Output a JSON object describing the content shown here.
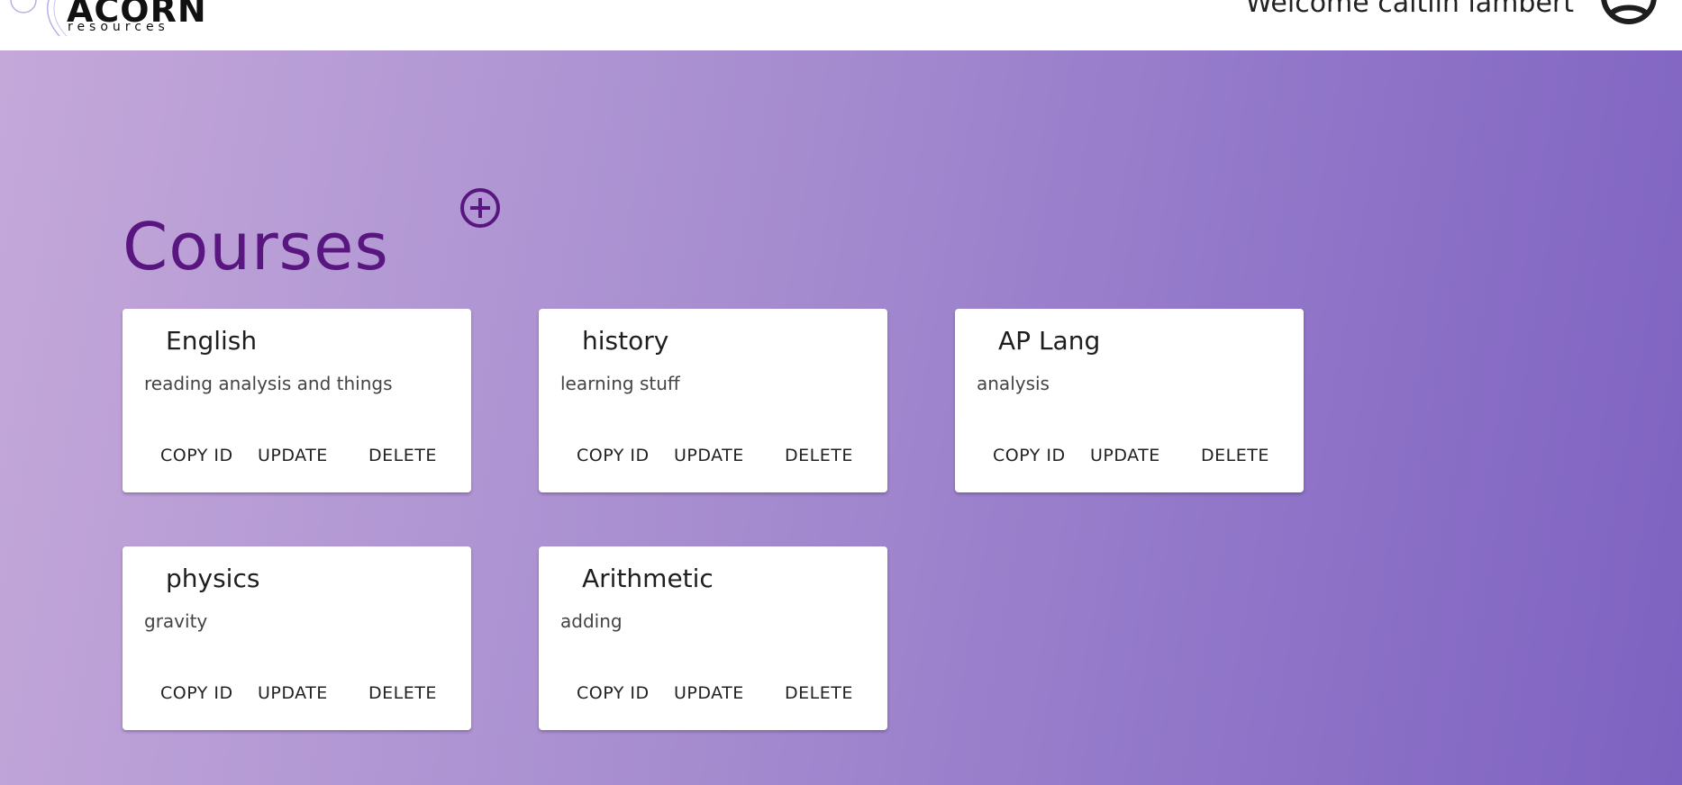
{
  "header": {
    "logo_word": "ACORN",
    "logo_sub": "resources",
    "welcome_text": "Welcome caitlin lambert"
  },
  "main": {
    "title": "Courses",
    "courses": [
      {
        "title": "English",
        "description": "reading analysis and things",
        "copy_label": "COPY ID",
        "update_label": "UPDATE",
        "delete_label": "DELETE"
      },
      {
        "title": "history",
        "description": "learning stuff",
        "copy_label": "COPY ID",
        "update_label": "UPDATE",
        "delete_label": "DELETE"
      },
      {
        "title": "AP Lang",
        "description": "analysis",
        "copy_label": "COPY ID",
        "update_label": "UPDATE",
        "delete_label": "DELETE"
      },
      {
        "title": "physics",
        "description": "gravity",
        "copy_label": "COPY ID",
        "update_label": "UPDATE",
        "delete_label": "DELETE"
      },
      {
        "title": "Arithmetic",
        "description": "adding",
        "copy_label": "COPY ID",
        "update_label": "UPDATE",
        "delete_label": "DELETE"
      }
    ]
  },
  "icons": {
    "add": "add-circle-icon",
    "avatar": "account-circle-icon",
    "logo": "acorn-logo-icon"
  },
  "colors": {
    "title_purple": "#5a1680",
    "gradient_start": "#c4a8da",
    "gradient_end": "#7e62c1",
    "card_bg": "#ffffff"
  }
}
